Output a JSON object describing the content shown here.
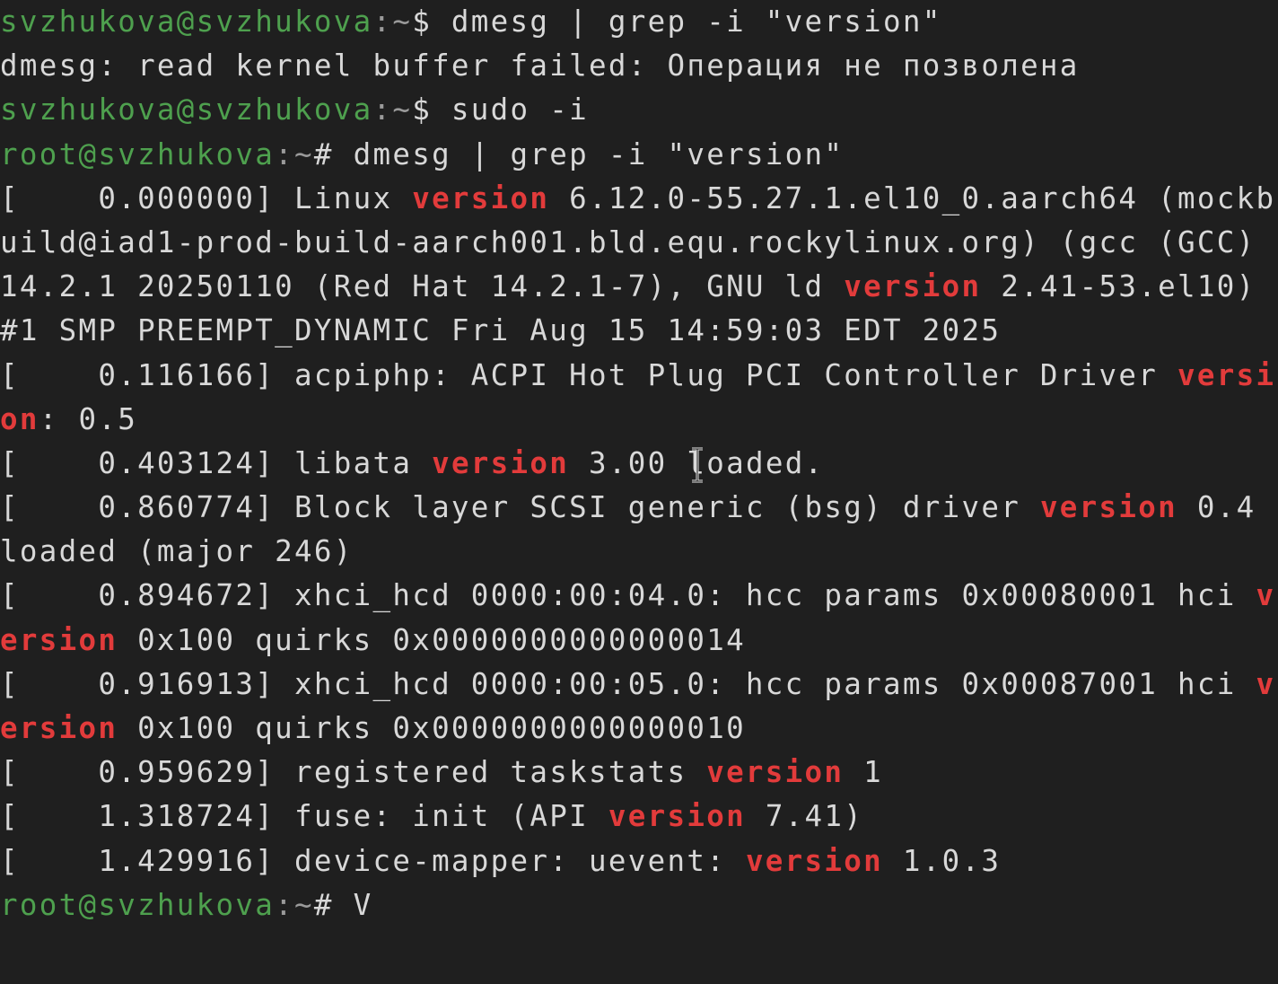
{
  "theme": {
    "background": "#1f1f1f",
    "foreground": "#d8d8d8",
    "prompt_user_color": "#4ea04e",
    "prompt_path_color": "#9a9a9a",
    "highlight_color": "#e23b3b"
  },
  "lines": [
    {
      "segments": [
        {
          "t": "svzhukova@svzhukova",
          "c": "user"
        },
        {
          "t": ":~",
          "c": "path"
        },
        {
          "t": "$ dmesg | grep -i \"version\""
        }
      ]
    },
    {
      "segments": [
        {
          "t": "dmesg: read kernel buffer failed: Операция не позволена"
        }
      ]
    },
    {
      "segments": [
        {
          "t": "svzhukova@svzhukova",
          "c": "user"
        },
        {
          "t": ":~",
          "c": "path"
        },
        {
          "t": "$ sudo -i"
        }
      ]
    },
    {
      "segments": [
        {
          "t": "root@svzhukova",
          "c": "user"
        },
        {
          "t": ":~",
          "c": "path"
        },
        {
          "t": "# dmesg | grep -i \"version\""
        }
      ]
    },
    {
      "segments": [
        {
          "t": "[    0.000000] Linux "
        },
        {
          "t": "version",
          "c": "hl"
        },
        {
          "t": " 6.12.0-55.27.1.el10_0.aarch64 (mockb"
        }
      ]
    },
    {
      "segments": [
        {
          "t": "uild@iad1-prod-build-aarch001.bld.equ.rockylinux.org) (gcc (GCC)"
        }
      ]
    },
    {
      "segments": [
        {
          "t": "14.2.1 20250110 (Red Hat 14.2.1-7), GNU ld "
        },
        {
          "t": "version",
          "c": "hl"
        },
        {
          "t": " 2.41-53.el10)"
        }
      ]
    },
    {
      "segments": [
        {
          "t": "#1 SMP PREEMPT_DYNAMIC Fri Aug 15 14:59:03 EDT 2025"
        }
      ]
    },
    {
      "segments": [
        {
          "t": "[    0.116166] acpiphp: ACPI Hot Plug PCI Controller Driver "
        },
        {
          "t": "versi",
          "c": "hl"
        }
      ]
    },
    {
      "segments": [
        {
          "t": "on",
          "c": "hl"
        },
        {
          "t": ": 0.5"
        }
      ]
    },
    {
      "segments": [
        {
          "t": "[    0.403124] libata "
        },
        {
          "t": "version",
          "c": "hl"
        },
        {
          "t": " 3.00 loaded."
        }
      ]
    },
    {
      "segments": [
        {
          "t": "[    0.860774] Block layer SCSI generic (bsg) driver "
        },
        {
          "t": "version",
          "c": "hl"
        },
        {
          "t": " 0.4"
        }
      ]
    },
    {
      "segments": [
        {
          "t": "loaded (major 246)"
        }
      ]
    },
    {
      "segments": [
        {
          "t": "[    0.894672] xhci_hcd 0000:00:04.0: hcc params 0x00080001 hci "
        },
        {
          "t": "v",
          "c": "hl"
        }
      ]
    },
    {
      "segments": [
        {
          "t": "ersion",
          "c": "hl"
        },
        {
          "t": " 0x100 quirks 0x0000000000000014"
        }
      ]
    },
    {
      "segments": [
        {
          "t": "[    0.916913] xhci_hcd 0000:00:05.0: hcc params 0x00087001 hci "
        },
        {
          "t": "v",
          "c": "hl"
        }
      ]
    },
    {
      "segments": [
        {
          "t": "ersion",
          "c": "hl"
        },
        {
          "t": " 0x100 quirks 0x0000000000000010"
        }
      ]
    },
    {
      "segments": [
        {
          "t": "[    0.959629] registered taskstats "
        },
        {
          "t": "version",
          "c": "hl"
        },
        {
          "t": " 1"
        }
      ]
    },
    {
      "segments": [
        {
          "t": "[    1.318724] fuse: init (API "
        },
        {
          "t": "version",
          "c": "hl"
        },
        {
          "t": " 7.41)"
        }
      ]
    },
    {
      "segments": [
        {
          "t": "[    1.429916] device-mapper: uevent: "
        },
        {
          "t": "version",
          "c": "hl"
        },
        {
          "t": " 1.0.3"
        }
      ]
    },
    {
      "segments": [
        {
          "t": "root@svzhukova",
          "c": "user"
        },
        {
          "t": ":~",
          "c": "path"
        },
        {
          "t": "# V"
        }
      ]
    }
  ],
  "mouse_cursor_icon": "ibeam-cursor-icon"
}
